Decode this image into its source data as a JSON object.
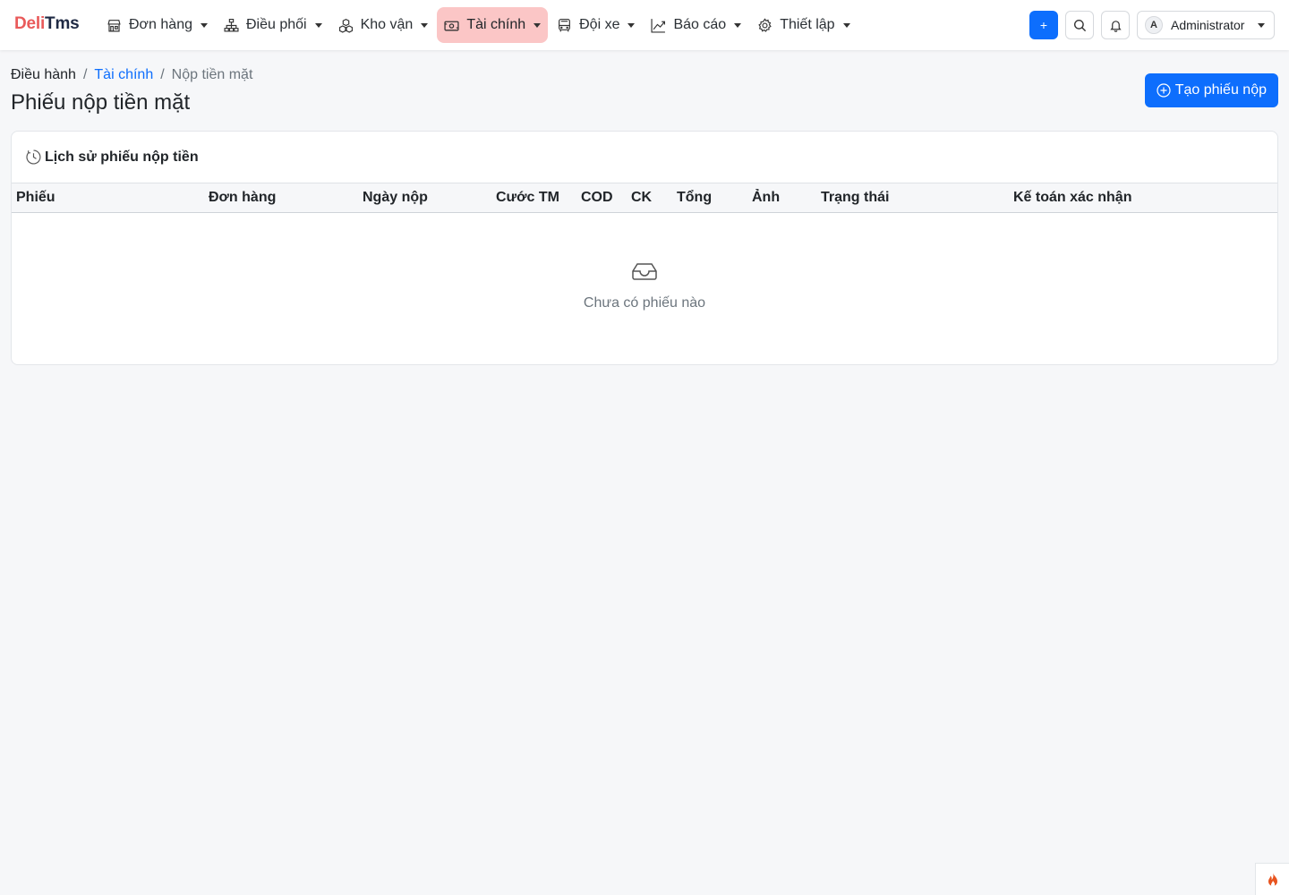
{
  "brand": {
    "part1": "Deli",
    "part2": "Tms"
  },
  "nav": {
    "items": [
      {
        "label": "Đơn hàng",
        "icon": "shop-icon"
      },
      {
        "label": "Điều phối",
        "icon": "diagram-icon"
      },
      {
        "label": "Kho vận",
        "icon": "boxes-icon"
      },
      {
        "label": "Tài chính",
        "icon": "cash-icon",
        "active": true
      },
      {
        "label": "Đội xe",
        "icon": "bus-icon"
      },
      {
        "label": "Báo cáo",
        "icon": "graph-up-icon"
      },
      {
        "label": "Thiết lập",
        "icon": "gear-icon"
      }
    ],
    "plus_label": "+",
    "user": {
      "initial": "A",
      "name": "Administrator"
    }
  },
  "breadcrumb": {
    "home": "Điều hành",
    "section": "Tài chính",
    "current": "Nộp tiền mặt"
  },
  "page": {
    "title": "Phiếu nộp tiền mặt",
    "create_label": "Tạo phiếu nộp"
  },
  "card": {
    "title": "Lịch sử phiếu nộp tiền",
    "columns": [
      "Phiếu",
      "Đơn hàng",
      "Ngày nộp",
      "Cước TM",
      "COD",
      "CK",
      "Tổng",
      "Ảnh",
      "Trạng thái",
      "Kế toán xác nhận"
    ],
    "rows": [],
    "empty_text": "Chưa có phiếu nào"
  },
  "colors": {
    "primary": "#0d6efd",
    "active_nav": "#fbc6c6",
    "brand_red": "#e95a5a",
    "brand_dark": "#1f2a44"
  }
}
